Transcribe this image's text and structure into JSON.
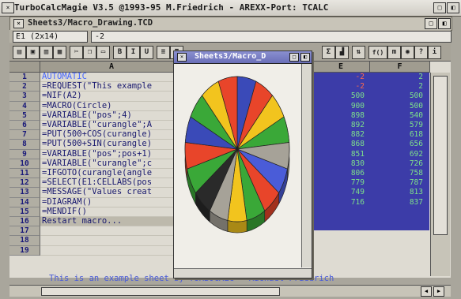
{
  "app": {
    "title": "TurboCalcMagie V3.5 @1993-95 M.Friedrich - AREXX-Port: TCALC"
  },
  "document": {
    "title": "Sheets3/Macro_Drawing.TCD"
  },
  "formula_bar": {
    "cell_ref": "E1 (2x14)",
    "content": "-2"
  },
  "toolbar": {
    "bold": "B",
    "italic": "I",
    "underline": "U",
    "view": "View",
    "numeric": "f()"
  },
  "columns": {
    "A": "A",
    "E": "E",
    "F": "F"
  },
  "rows": [
    {
      "n": "1",
      "a": "AUTOMATIC"
    },
    {
      "n": "2",
      "a": "=REQUEST(\"This example"
    },
    {
      "n": "3",
      "a": "=NIF(A2)"
    },
    {
      "n": "4",
      "a": "=MACRO(Circle)"
    },
    {
      "n": "5",
      "a": "=VARIABLE(\"pos\";4)"
    },
    {
      "n": "6",
      "a": "=VARIABLE(\"curangle\";A"
    },
    {
      "n": "7",
      "a": "=PUT(500+COS(curangle)"
    },
    {
      "n": "8",
      "a": "=PUT(500+SIN(curangle)"
    },
    {
      "n": "9",
      "a": "=VARIABLE(\"pos\";pos+1)"
    },
    {
      "n": "10",
      "a": "=VARIABLE(\"curangle\";c"
    },
    {
      "n": "11",
      "a": "=IFGOTO(curangle(angle"
    },
    {
      "n": "12",
      "a": "=SELECT(E1:CELLABS(pos"
    },
    {
      "n": "13",
      "a": "=MESSAGE(\"Values creat"
    },
    {
      "n": "14",
      "a": "=DIAGRAM()"
    },
    {
      "n": "15",
      "a": "=MENDIF()"
    },
    {
      "n": "16",
      "a": "Restart macro..."
    },
    {
      "n": "17",
      "a": ""
    },
    {
      "n": "18",
      "a": ""
    },
    {
      "n": "19",
      "a": ""
    }
  ],
  "columnE": [
    "-2",
    "-2",
    "500",
    "900",
    "898",
    "892",
    "882",
    "868",
    "851",
    "830",
    "806",
    "779",
    "749",
    "716"
  ],
  "columnF": [
    "2",
    "2",
    "500",
    "500",
    "540",
    "579",
    "618",
    "656",
    "692",
    "726",
    "758",
    "787",
    "813",
    "837"
  ],
  "footer_note": "This is an example sheet by TURBOCALC - Michael Friedrich",
  "chart_window": {
    "title": "Sheets3/Macro_D"
  },
  "chart_data": {
    "type": "pie",
    "title": "",
    "slices": [
      {
        "color": "#3a4ab8"
      },
      {
        "color": "#e8452a"
      },
      {
        "color": "#f2c41e"
      },
      {
        "color": "#3aa838"
      },
      {
        "color": "#a6a298"
      },
      {
        "color": "#4a5cd8"
      },
      {
        "color": "#e8452a"
      },
      {
        "color": "#3aa838"
      },
      {
        "color": "#f2c41e"
      },
      {
        "color": "#a6a298"
      },
      {
        "color": "#2a2a2a"
      },
      {
        "color": "#3aa838"
      },
      {
        "color": "#e8452a"
      },
      {
        "color": "#3a4ab8"
      },
      {
        "color": "#3aa838"
      },
      {
        "color": "#f2c41e"
      },
      {
        "color": "#e8452a"
      }
    ],
    "three_d": true
  }
}
